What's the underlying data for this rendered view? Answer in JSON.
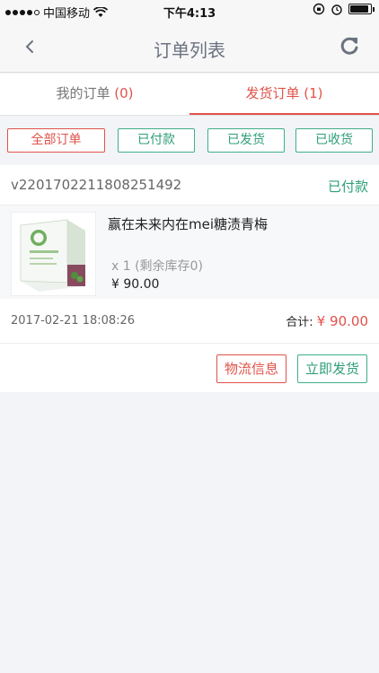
{
  "status_bar": {
    "carrier": "中国移动",
    "time": "下午4:13",
    "battery_level": 0.92
  },
  "nav": {
    "title": "订单列表",
    "back_icon": "chevron-left-icon",
    "refresh_icon": "refresh-icon"
  },
  "tabs": [
    {
      "label": "我的订单",
      "count": "(0)",
      "active": false
    },
    {
      "label": "发货订单",
      "count": "(1)",
      "active": true
    }
  ],
  "filters": [
    {
      "label": "全部订单",
      "active": true
    },
    {
      "label": "已付款",
      "active": false
    },
    {
      "label": "已发货",
      "active": false
    },
    {
      "label": "已收货",
      "active": false
    }
  ],
  "order": {
    "number": "v2201702211808251492",
    "status": "已付款",
    "product_name": "赢在未来内在mei糖渍青梅",
    "quantity": "x  1 (剩余库存0)",
    "price": "¥  90.00",
    "date": "2017-02-21 18:08:26",
    "total_label": "合计:",
    "total_value": "¥ 90.00",
    "actions": [
      "物流信息",
      "立即发货"
    ]
  },
  "colors": {
    "accent_red": "#e0524a",
    "accent_green": "#2e9e78"
  }
}
